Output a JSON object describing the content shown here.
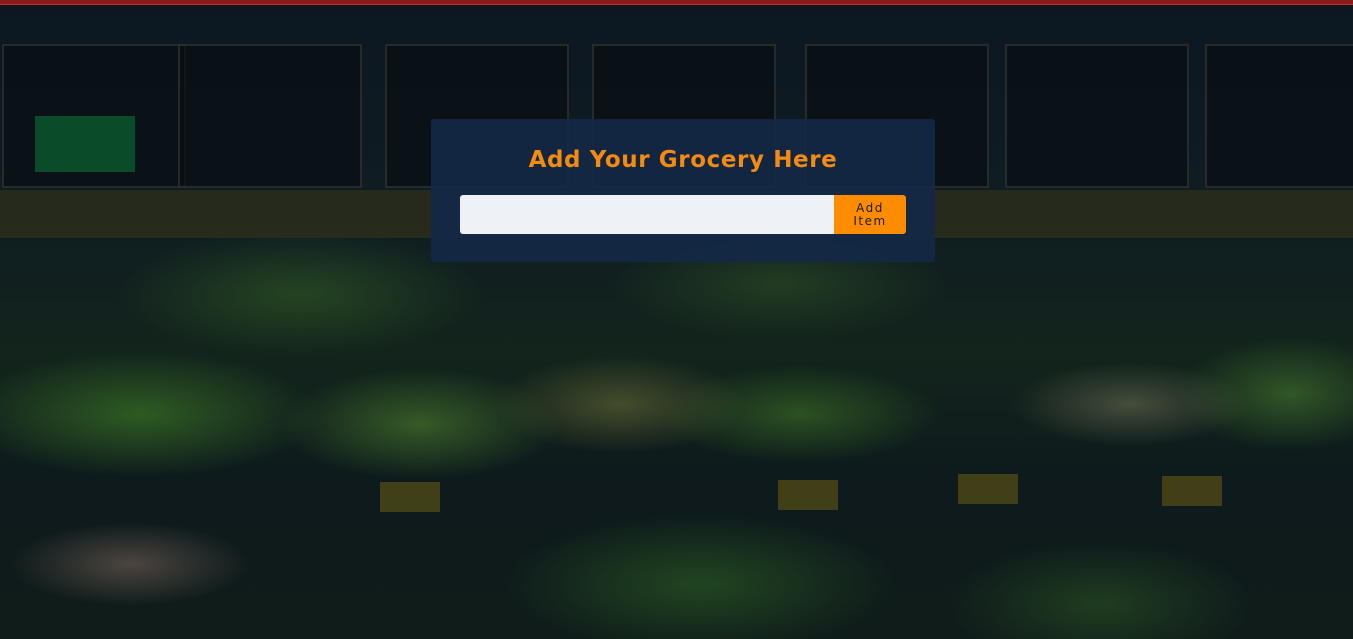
{
  "form": {
    "title": "Add Your Grocery Here",
    "input_value": "",
    "input_placeholder": "",
    "button_label": "Add Item"
  },
  "colors": {
    "top_bar": "#8a1a1a",
    "card_background": "#13284a",
    "title": "#f48a10",
    "button": "#ff8c00",
    "input_background": "#eef2f6"
  },
  "background": {
    "description_icon": "grocery-produce-background"
  }
}
